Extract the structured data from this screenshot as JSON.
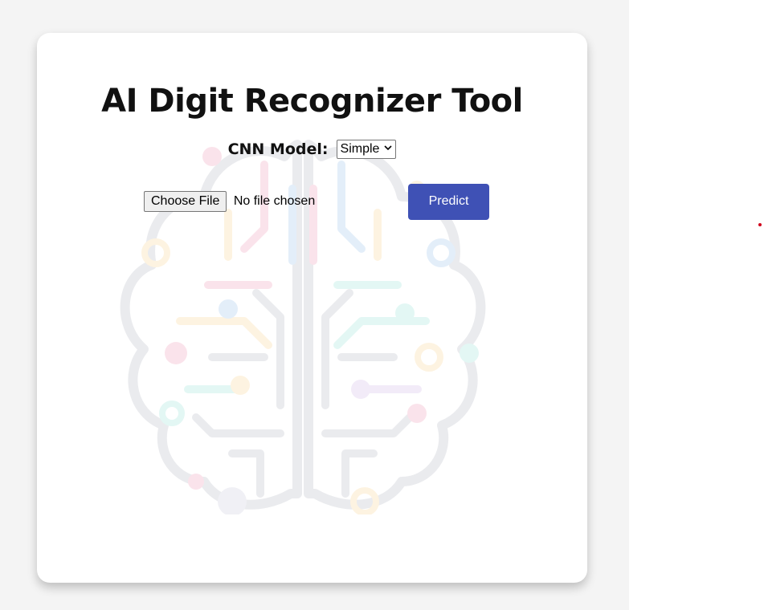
{
  "header": {
    "title": "AI Digit Recognizer Tool"
  },
  "model": {
    "label": "CNN Model:",
    "selected": "Simple"
  },
  "upload": {
    "button_label": "Choose File",
    "status": "No file chosen"
  },
  "actions": {
    "predict_label": "Predict"
  },
  "colors": {
    "accent": "#3f51b5",
    "page_bg": "#f4f4f4",
    "card_bg": "#ffffff",
    "indicator_dot": "#d0021b"
  },
  "icons": {
    "background": "brain-circuit-icon",
    "select_arrow": "chevron-down-icon"
  }
}
